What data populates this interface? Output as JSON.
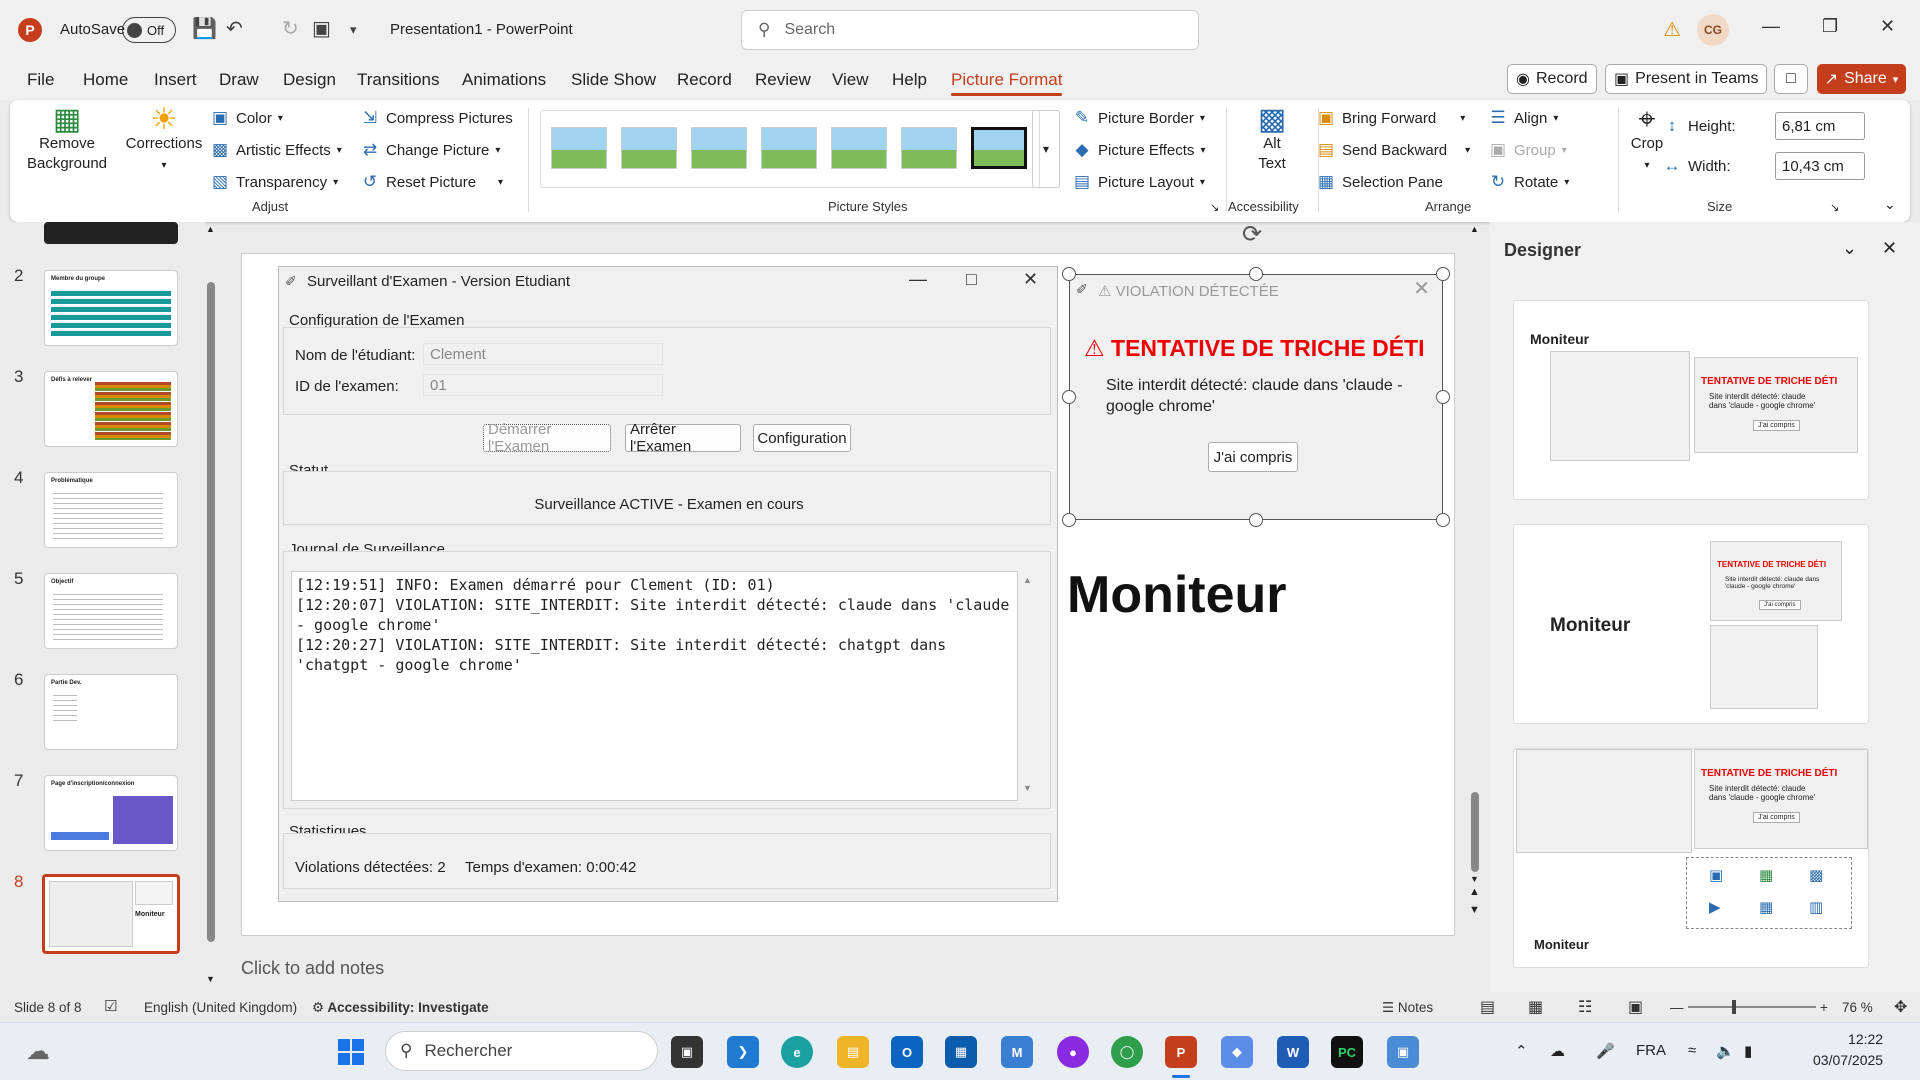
{
  "titlebar": {
    "app_logo": "P",
    "autosave_label": "AutoSave",
    "autosave_state": "Off",
    "document_title": "Presentation1",
    "app_name": "PowerPoint",
    "title_separator": " - ",
    "search_placeholder": "Search",
    "user_initials": "CG"
  },
  "menu": {
    "tabs": [
      "File",
      "Home",
      "Insert",
      "Draw",
      "Design",
      "Transitions",
      "Animations",
      "Slide Show",
      "Record",
      "Review",
      "View",
      "Help",
      "Picture Format"
    ],
    "active_tab": "Picture Format",
    "record_button": "Record",
    "present_teams_button": "Present in Teams",
    "share_button": "Share"
  },
  "ribbon": {
    "adjust": {
      "remove_background": [
        "Remove",
        "Background"
      ],
      "corrections": "Corrections",
      "color": "Color",
      "artistic_effects": "Artistic Effects",
      "transparency": "Transparency",
      "compress": "Compress Pictures",
      "change": "Change Picture",
      "reset": "Reset Picture",
      "label": "Adjust"
    },
    "styles": {
      "label": "Picture Styles",
      "count": 7
    },
    "picture_options": {
      "border": "Picture Border",
      "effects": "Picture Effects",
      "layout": "Picture Layout"
    },
    "accessibility": {
      "alt_text": [
        "Alt",
        "Text"
      ],
      "label": "Accessibility"
    },
    "arrange": {
      "bring_forward": "Bring Forward",
      "send_backward": "Send Backward",
      "selection_pane": "Selection Pane",
      "align": "Align",
      "group": "Group",
      "rotate": "Rotate",
      "label": "Arrange"
    },
    "size": {
      "crop": "Crop",
      "height_label": "Height:",
      "height_value": "6,81 cm",
      "width_label": "Width:",
      "width_value": "10,43 cm",
      "label": "Size"
    }
  },
  "thumbnails": [
    {
      "num": "2",
      "title": "Membre du groupe",
      "color": "#1a9b9b"
    },
    {
      "num": "3",
      "title": "Défis à relever",
      "color": "#6c9a2e"
    },
    {
      "num": "4",
      "title": "Problématique",
      "color": "#888888"
    },
    {
      "num": "5",
      "title": "Objectif",
      "color": "#888888"
    },
    {
      "num": "6",
      "title": "Partie Dev.",
      "color": "#888888"
    },
    {
      "num": "7",
      "title": "Page d'inscription/connexion",
      "color": "#6a57c8"
    },
    {
      "num": "8",
      "title": "Moniteur",
      "color": "#c43e1c"
    }
  ],
  "monitor_window": {
    "title": "Surveillant d'Examen - Version Etudiant",
    "config_title": "Configuration de l'Examen",
    "student_label": "Nom de l'étudiant:",
    "student_value": "Clement",
    "exam_label": "ID de l'examen:",
    "exam_value": "01",
    "start_button": "Démarrer l'Examen",
    "stop_button": "Arrêter l'Examen",
    "config_button": "Configuration",
    "status_title": "Statut",
    "status_text": "Surveillance ACTIVE - Examen en cours",
    "log_title": "Journal de Surveillance",
    "log_text": "[12:19:51] INFO: Examen démarré pour Clement (ID: 01)\n[12:20:07] VIOLATION: SITE_INTERDIT: Site interdit détecté: claude dans 'claude - google chrome'\n[12:20:27] VIOLATION: SITE_INTERDIT: Site interdit détecté: chatgpt dans 'chatgpt - google chrome'",
    "stats_title": "Statistiques",
    "violations": "Violations détectées: 2",
    "duration": "Temps d'examen: 0:00:42"
  },
  "violation_popup": {
    "title": "VIOLATION DÉTECTÉE",
    "heading": "TENTATIVE DE TRICHE DÉTI",
    "message": "Site interdit détecté: claude dans 'claude - google chrome'",
    "button": "J'ai compris"
  },
  "slide": {
    "title": "Moniteur",
    "notes_placeholder": "Click to add notes"
  },
  "designer": {
    "title": "Designer",
    "cards": [
      {
        "title": "Moniteur",
        "heading": "TENTATIVE DE TRICHE DÉTI",
        "message": "Site interdit détecté: claude dans 'claude - google chrome'",
        "button": "J'ai compris"
      },
      {
        "title": "Moniteur",
        "heading": "TENTATIVE DE TRICHE DÉTI",
        "message": "Site interdit détecté: claude dans 'claude - google chrome'",
        "button": "J'ai compris"
      },
      {
        "title": "Moniteur",
        "heading": "TENTATIVE DE TRICHE DÉTI",
        "message": "Site interdit détecté: claude dans 'claude - google chrome'",
        "button": "J'ai compris"
      }
    ]
  },
  "statusbar": {
    "slide_info": "Slide 8 of 8",
    "language": "English (United Kingdom)",
    "accessibility": "Accessibility: Investigate",
    "notes": "Notes",
    "zoom": "76 %"
  },
  "taskbar": {
    "search_placeholder": "Rechercher",
    "language": "FRA",
    "time": "12:22",
    "date": "03/07/2025"
  }
}
